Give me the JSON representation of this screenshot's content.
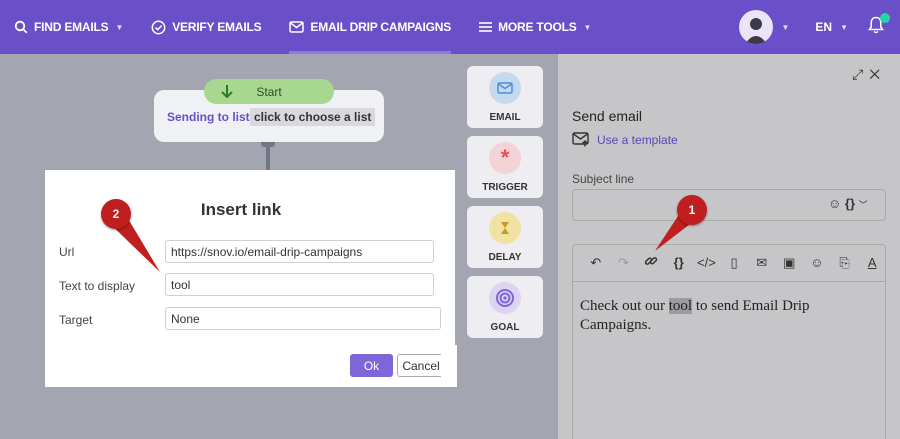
{
  "nav": {
    "items": [
      {
        "label": "FIND EMAILS",
        "icon": "search-icon",
        "has_caret": true
      },
      {
        "label": "VERIFY EMAILS",
        "icon": "check-circle-icon",
        "has_caret": false
      },
      {
        "label": "EMAIL DRIP CAMPAIGNS",
        "icon": "envelope-icon",
        "active": true
      },
      {
        "label": "MORE TOOLS",
        "icon": "menu-icon",
        "has_caret": true
      }
    ],
    "language": "EN",
    "accent_color": "#6a50c8",
    "notification_dot_color": "#27d3a2"
  },
  "flow": {
    "start_label": "Start",
    "sending_label": "Sending to list",
    "choose_label": "click to choose a list"
  },
  "toolbox": {
    "items": [
      {
        "label": "EMAIL",
        "icon": "envelope-icon"
      },
      {
        "label": "TRIGGER",
        "icon": "asterisk-icon"
      },
      {
        "label": "DELAY",
        "icon": "hourglass-icon"
      },
      {
        "label": "GOAL",
        "icon": "target-icon"
      }
    ]
  },
  "panel": {
    "title": "Send email",
    "template_link": "Use a template",
    "subject_label": "Subject line",
    "subject_value": "",
    "subject_tools": "☺ {}",
    "editor_text_before": "Check out our ",
    "editor_text_selected": "tool",
    "editor_text_after": " to send Email Drip Campaigns."
  },
  "dialog": {
    "title": "Insert link",
    "url_label": "Url",
    "url_value": "https://snov.io/email-drip-campaigns",
    "text_label": "Text to display",
    "text_value": "tool",
    "target_label": "Target",
    "target_value": "None",
    "ok_label": "Ok",
    "cancel_label": "Cancel"
  },
  "markers": {
    "one": "1",
    "two": "2"
  }
}
